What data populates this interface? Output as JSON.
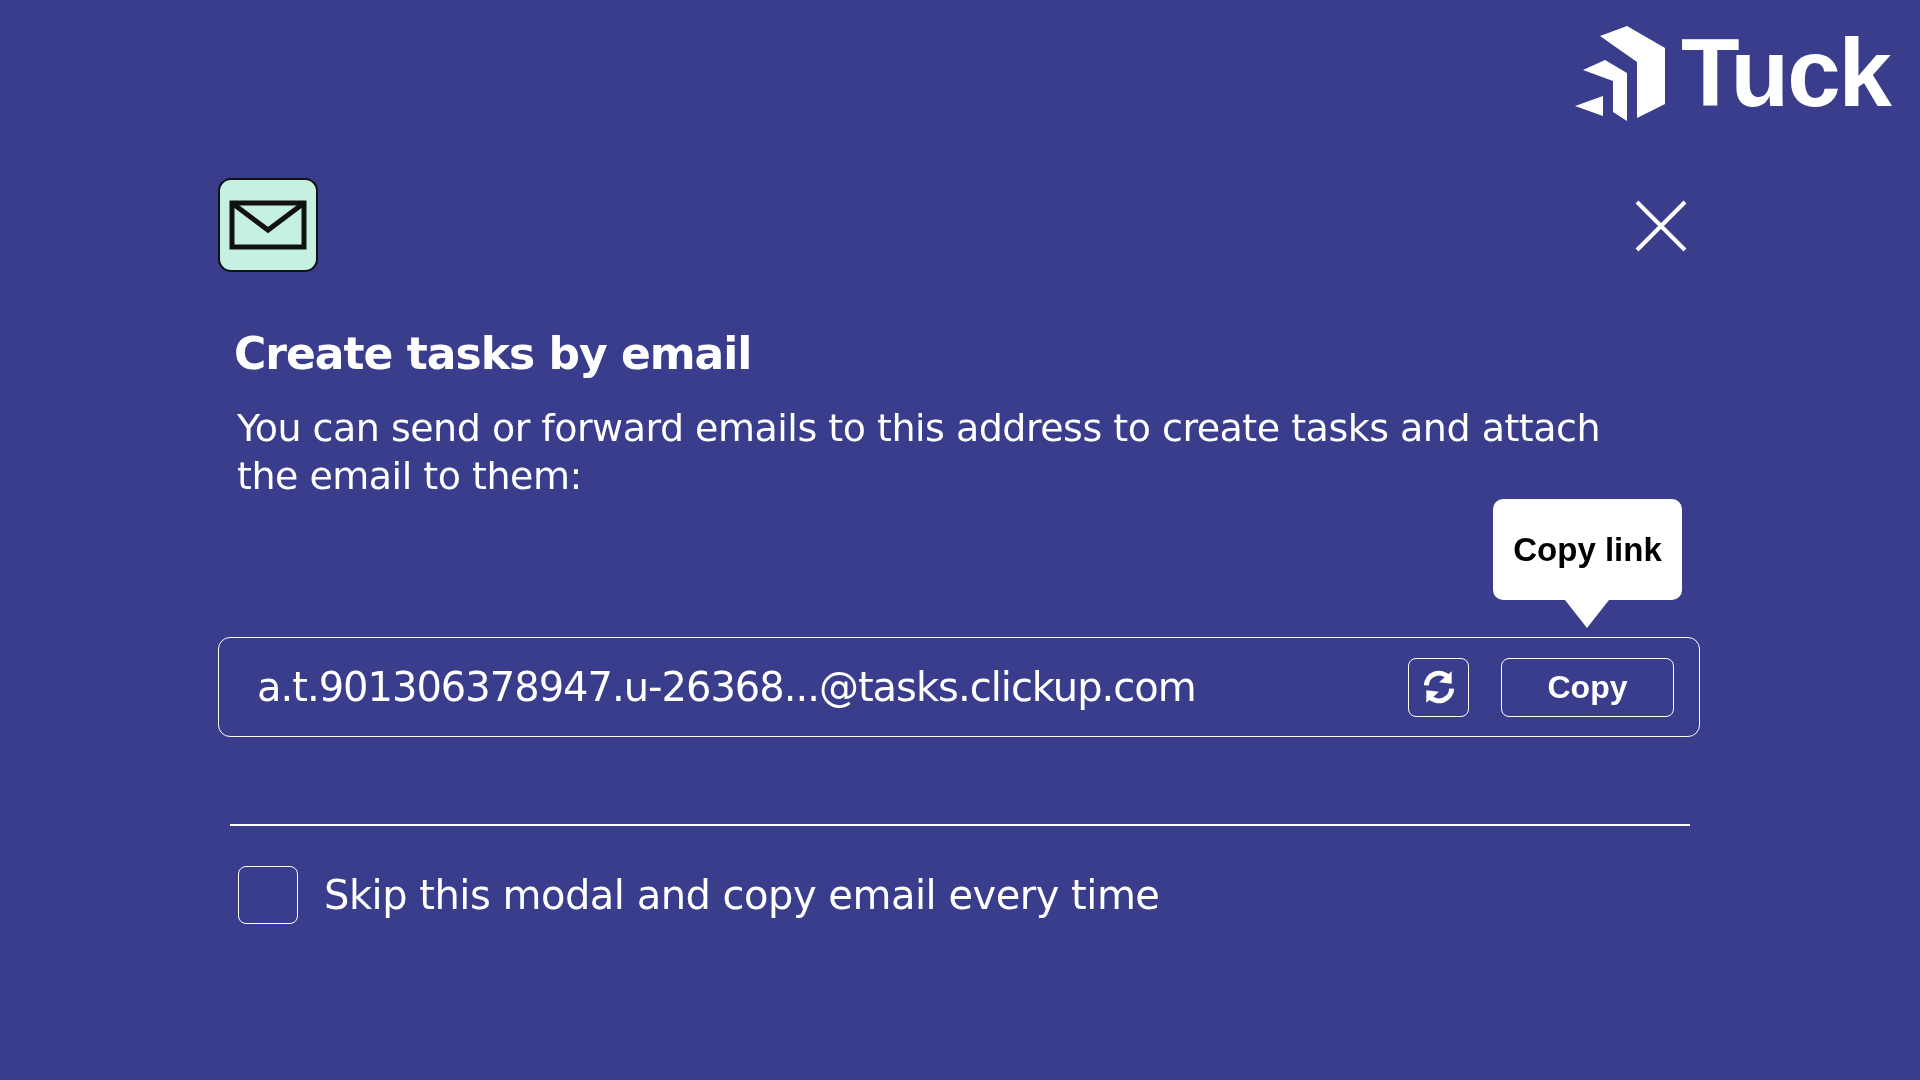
{
  "brand": {
    "name": "Tuck"
  },
  "modal": {
    "title": "Create tasks by email",
    "description": "You can send or forward emails to this address to create tasks and attach the email to them:",
    "address": "a.t.901306378947.u-26368...@tasks.clickup.com",
    "tooltip": "Copy link",
    "copy_button": "Copy",
    "skip": {
      "label": "Skip this modal and copy email every time",
      "checked": false
    }
  }
}
